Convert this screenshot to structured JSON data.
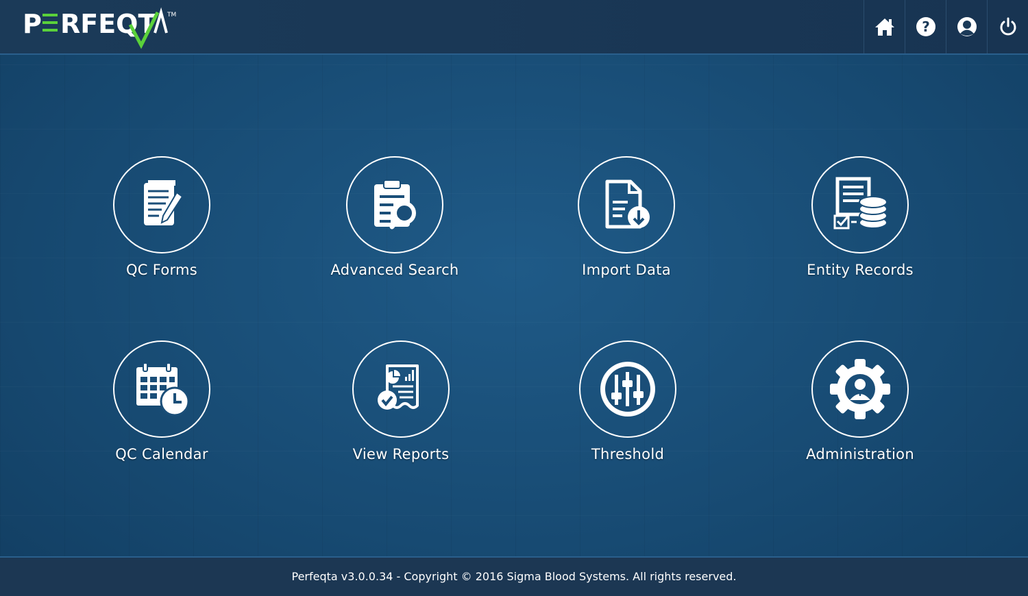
{
  "header": {
    "logo_text": "PERFEQTA",
    "logo_tm": "TM",
    "accent_color": "#5ad13a",
    "actions": [
      {
        "icon": "home-icon"
      },
      {
        "icon": "help-icon"
      },
      {
        "icon": "user-icon"
      },
      {
        "icon": "power-icon"
      }
    ]
  },
  "tiles": [
    {
      "label": "QC Forms",
      "icon": "form-edit-icon"
    },
    {
      "label": "Advanced Search",
      "icon": "document-search-icon"
    },
    {
      "label": "Import Data",
      "icon": "document-download-icon"
    },
    {
      "label": "Entity Records",
      "icon": "database-records-icon"
    },
    {
      "label": "QC Calendar",
      "icon": "calendar-clock-icon"
    },
    {
      "label": "View Reports",
      "icon": "report-check-icon"
    },
    {
      "label": "Threshold",
      "icon": "sliders-icon"
    },
    {
      "label": "Administration",
      "icon": "admin-gear-icon"
    }
  ],
  "footer": {
    "text": "Perfeqta v3.0.0.34 - Copyright © 2016 Sigma Blood Systems. All rights reserved."
  },
  "colors": {
    "background": "#1a4e78",
    "topbar": "#1b3a58",
    "footer": "#1c3753",
    "text": "#ffffff"
  }
}
